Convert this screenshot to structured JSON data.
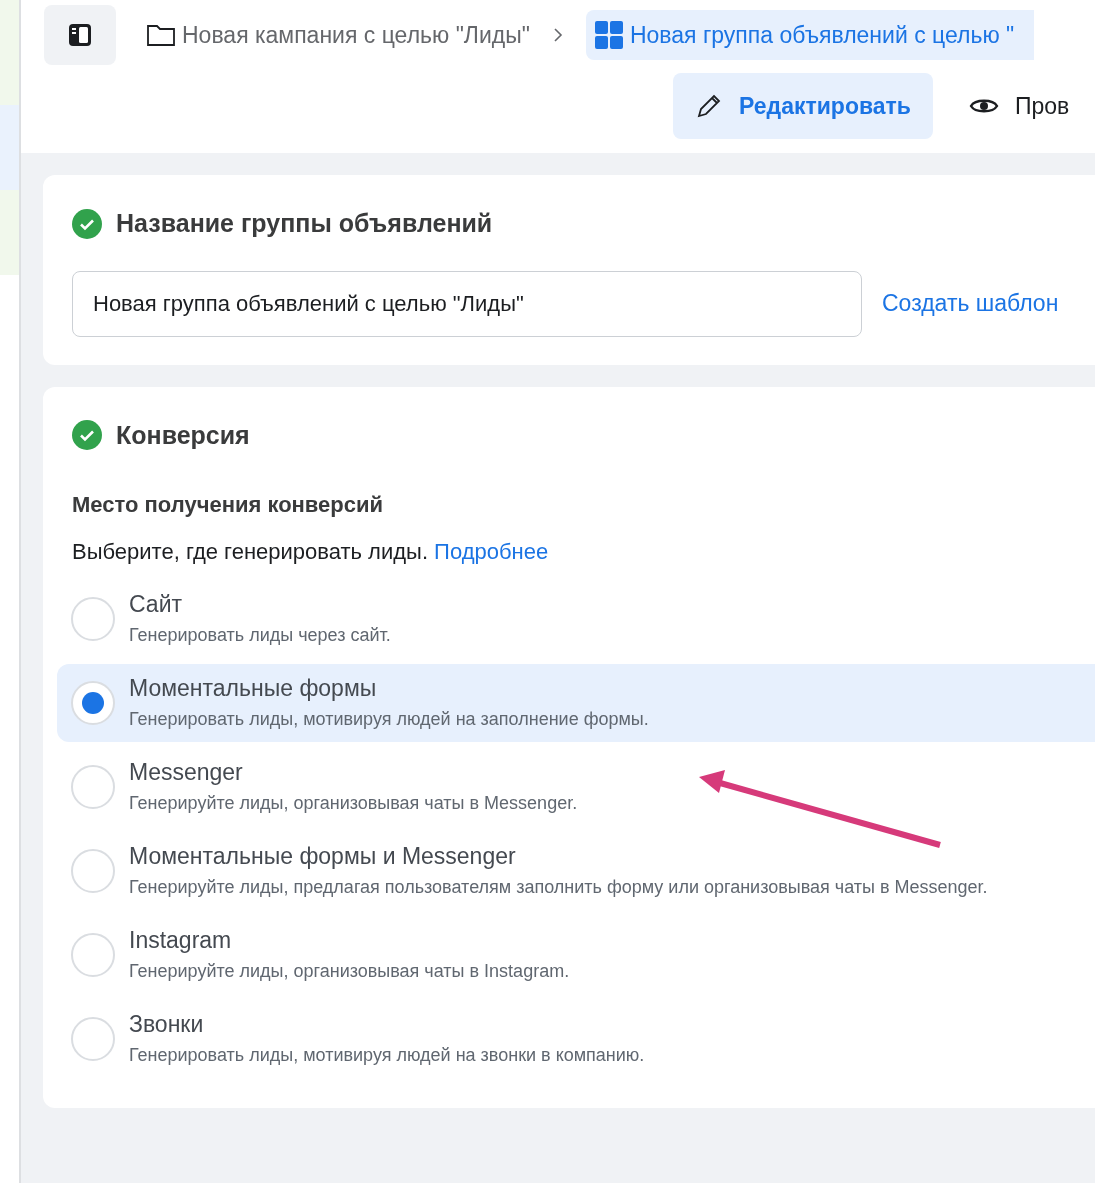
{
  "breadcrumb": [
    {
      "label": "Новая кампания с целью \"Лиды\"",
      "kind": "folder",
      "selected": false
    },
    {
      "label": "Новая группа объявлений с целью \"",
      "kind": "grid",
      "selected": true
    }
  ],
  "actions": [
    {
      "label": "Редактировать",
      "kind": "edit",
      "selected": true
    },
    {
      "label": "Пров",
      "kind": "view",
      "selected": false
    }
  ],
  "name_section": {
    "title": "Название группы объявлений",
    "complete": true,
    "value": "Новая группа объявлений с целью \"Лиды\"",
    "link": "Создать шаблон"
  },
  "conversion_section": {
    "title": "Конверсия",
    "complete": true,
    "subtitle": "Место получения конверсий",
    "hint": "Выберите, где генерировать лиды.",
    "hint_link": "Подробнее",
    "options": [
      {
        "label": "Сайт",
        "description": "Генерировать лиды через сайт.",
        "selected": false
      },
      {
        "label": "Моментальные формы",
        "description": "Генерировать лиды, мотивируя людей на заполнение формы.",
        "selected": true
      },
      {
        "label": "Messenger",
        "description": "Генерируйте лиды, организовывая чаты в Messenger.",
        "selected": false
      },
      {
        "label": "Моментальные формы и Messenger",
        "description": "Генерируйте лиды, предлагая пользователям заполнить форму или организовывая чаты в Messenger.",
        "selected": false
      },
      {
        "label": "Instagram",
        "description": "Генерируйте лиды, организовывая чаты в Instagram.",
        "selected": false
      },
      {
        "label": "Звонки",
        "description": "Генерировать лиды, мотивируя людей на звонки в компанию.",
        "selected": false
      }
    ]
  },
  "annotation": {
    "kind": "arrow",
    "color": "#d63a7a"
  }
}
